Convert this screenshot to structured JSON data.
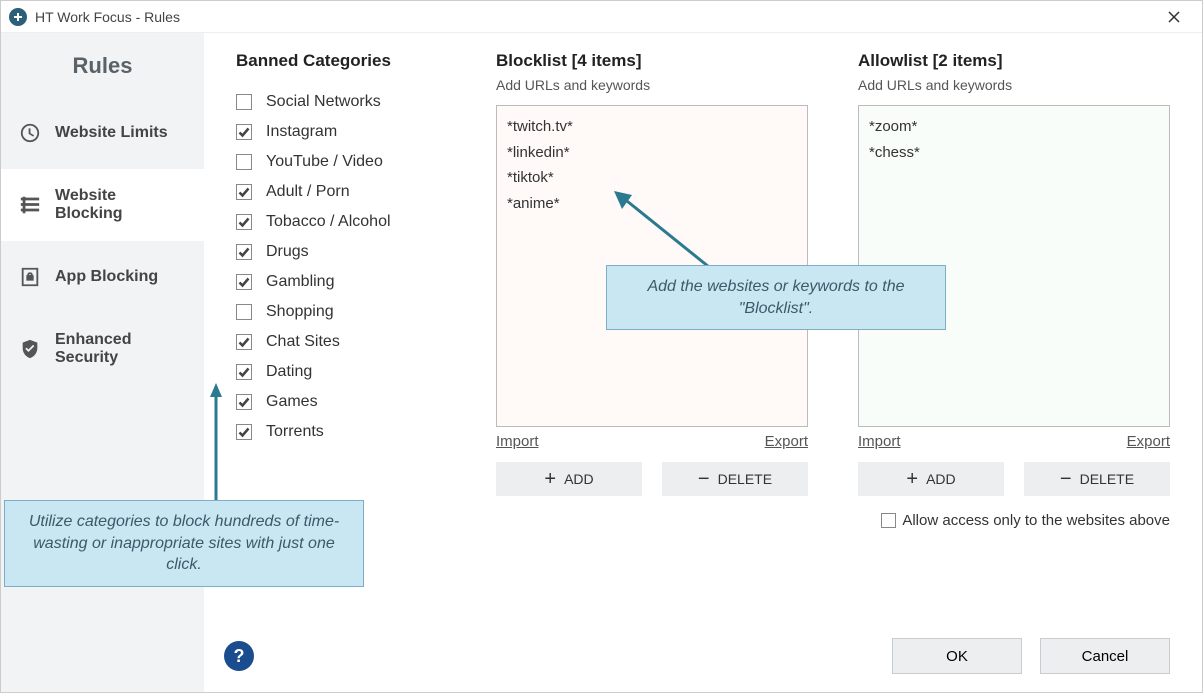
{
  "window": {
    "title": "HT Work Focus - Rules"
  },
  "sidebar": {
    "heading": "Rules",
    "items": [
      {
        "id": "website-limits",
        "label": "Website Limits",
        "active": false
      },
      {
        "id": "website-blocking",
        "label": "Website Blocking",
        "active": true
      },
      {
        "id": "app-blocking",
        "label": "App Blocking",
        "active": false
      },
      {
        "id": "enhanced-security",
        "label": "Enhanced Security",
        "active": false
      }
    ]
  },
  "banned": {
    "title": "Banned Categories",
    "categories": [
      {
        "label": "Social Networks",
        "checked": false
      },
      {
        "label": "Instagram",
        "checked": true
      },
      {
        "label": "YouTube / Video",
        "checked": false
      },
      {
        "label": "Adult / Porn",
        "checked": true
      },
      {
        "label": "Tobacco / Alcohol",
        "checked": true
      },
      {
        "label": "Drugs",
        "checked": true
      },
      {
        "label": "Gambling",
        "checked": true
      },
      {
        "label": "Shopping",
        "checked": false
      },
      {
        "label": "Chat Sites",
        "checked": true
      },
      {
        "label": "Dating",
        "checked": true
      },
      {
        "label": "Games",
        "checked": true
      },
      {
        "label": "Torrents",
        "checked": true
      }
    ]
  },
  "blocklist": {
    "title": "Blocklist [4 items]",
    "sub": "Add URLs and keywords",
    "items": [
      "*twitch.tv*",
      "*linkedin*",
      "*tiktok*",
      "*anime*"
    ],
    "import": "Import",
    "export": "Export",
    "add": "ADD",
    "delete": "DELETE"
  },
  "allowlist": {
    "title": "Allowlist [2 items]",
    "sub": "Add URLs and keywords",
    "items": [
      "*zoom*",
      "*chess*"
    ],
    "import": "Import",
    "export": "Export",
    "add": "ADD",
    "delete": "DELETE",
    "only_label": "Allow access only to the websites above",
    "only_checked": false
  },
  "footer": {
    "ok": "OK",
    "cancel": "Cancel"
  },
  "callouts": {
    "categories": "Utilize categories to block hundreds of time-wasting or inappropriate sites with just one click.",
    "blocklist": "Add the websites or keywords to the \"Blocklist\"."
  }
}
